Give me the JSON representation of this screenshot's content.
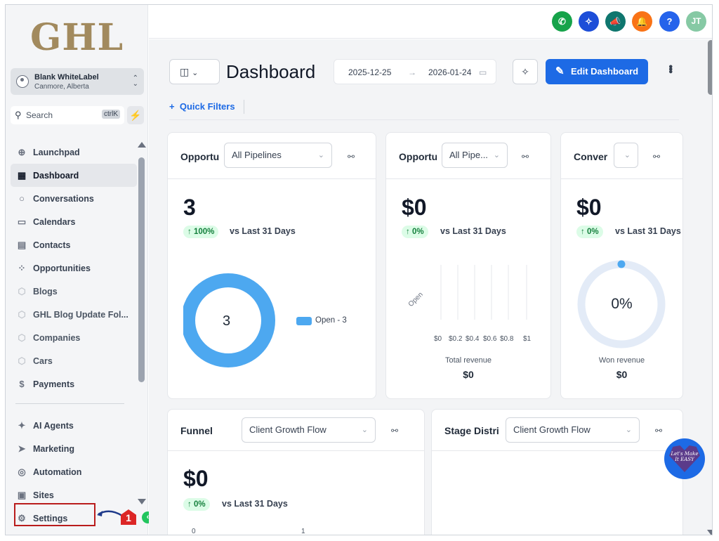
{
  "brand": {
    "logo_text": "GHL"
  },
  "account": {
    "name": "Blank WhiteLabel",
    "location": "Canmore, Alberta"
  },
  "search": {
    "label": "Search",
    "shortcut": "ctrlK"
  },
  "sidebar": {
    "items": [
      {
        "label": "Launchpad",
        "icon": "rocket-icon"
      },
      {
        "label": "Dashboard",
        "icon": "grid-icon"
      },
      {
        "label": "Conversations",
        "icon": "chat-icon"
      },
      {
        "label": "Calendars",
        "icon": "calendar-icon"
      },
      {
        "label": "Contacts",
        "icon": "contacts-icon"
      },
      {
        "label": "Opportunities",
        "icon": "opportunities-icon"
      },
      {
        "label": "Blogs",
        "icon": "cube-icon"
      },
      {
        "label": "GHL Blog Update Fol...",
        "icon": "cube-icon"
      },
      {
        "label": "Companies",
        "icon": "cube-icon"
      },
      {
        "label": "Cars",
        "icon": "cube-icon"
      },
      {
        "label": "Payments",
        "icon": "payments-icon"
      }
    ],
    "items2": [
      {
        "label": "AI Agents",
        "icon": "sparkle-icon"
      },
      {
        "label": "Marketing",
        "icon": "send-icon"
      },
      {
        "label": "Automation",
        "icon": "automation-icon"
      },
      {
        "label": "Sites",
        "icon": "sites-icon"
      },
      {
        "label": "Settings",
        "icon": "gear-icon"
      }
    ],
    "annotation_number": "1"
  },
  "topbar": {
    "avatar_initials": "JT",
    "help": "?"
  },
  "header": {
    "title": "Dashboard",
    "date_start": "2025-12-25",
    "date_end": "2026-01-24",
    "edit_label": "Edit Dashboard",
    "quick_filters": "Quick Filters"
  },
  "cards": {
    "c1": {
      "title": "Opportu",
      "select": "All Pipelines",
      "value": "3",
      "change": "↑ 100%",
      "vs": "vs Last 31 Days",
      "donut_center": "3",
      "legend": "Open - 3"
    },
    "c2": {
      "title": "Opportu",
      "select": "All Pipe...",
      "value": "$0",
      "change": "↑ 0%",
      "vs": "vs Last 31 Days",
      "y_label": "Open",
      "ticks": [
        "$0",
        "$0.2",
        "$0.4",
        "$0.6",
        "$0.8",
        "$1"
      ],
      "footer_label": "Total revenue",
      "footer_value": "$0"
    },
    "c3": {
      "title": "Conver",
      "value": "$0",
      "change": "↑ 0%",
      "vs": "vs Last 31 Days",
      "gauge": "0%",
      "footer_label": "Won revenue",
      "footer_value": "$0"
    },
    "c4": {
      "title": "Funnel",
      "select": "Client Growth Flow",
      "value": "$0",
      "change": "↑ 0%",
      "vs": "vs Last 31 Days",
      "axis_a": "0",
      "axis_b": "1"
    },
    "c5": {
      "title": "Stage Distri",
      "select": "Client Growth Flow"
    }
  },
  "chat_widget": {
    "text": "Let's Make It EASY"
  },
  "colors": {
    "primary": "#1d6ae5",
    "donut": "#4da8f0",
    "positive_bg": "#dcfce7",
    "positive_text": "#15803d",
    "annotation": "#b91c1c"
  }
}
